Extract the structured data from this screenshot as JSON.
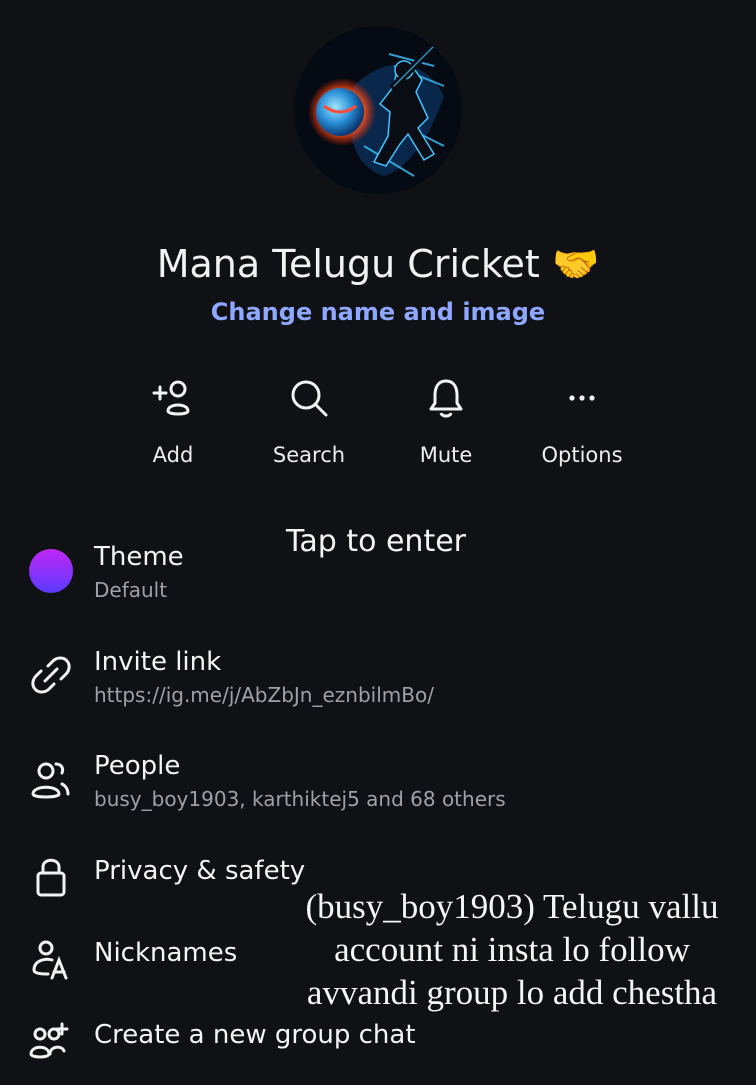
{
  "group": {
    "name": "Mana Telugu Cricket",
    "emoji": "🤝",
    "change_link": "Change name and image"
  },
  "actions": [
    {
      "label": "Add",
      "icon": "add-person-icon"
    },
    {
      "label": "Search",
      "icon": "search-icon"
    },
    {
      "label": "Mute",
      "icon": "bell-icon"
    },
    {
      "label": "Options",
      "icon": "more-dots-icon"
    }
  ],
  "overlay": {
    "tap_text": "Tap to enter",
    "note": "(busy_boy1903) Telugu vallu account ni insta lo follow avvandi group lo add chestha"
  },
  "menu": {
    "theme": {
      "title": "Theme",
      "subtitle": "Default",
      "colors": [
        "#c026f5",
        "#5a3bff"
      ]
    },
    "invite": {
      "title": "Invite link",
      "subtitle": "https://ig.me/j/AbZbJn_eznbilmBo/"
    },
    "people": {
      "title": "People",
      "subtitle": "busy_boy1903, karthiktej5 and 68 others"
    },
    "privacy": {
      "title": "Privacy & safety"
    },
    "nicknames": {
      "title": "Nicknames"
    },
    "create_group": {
      "title": "Create a new group chat"
    }
  },
  "colors": {
    "background": "#0f1115",
    "accent_link": "#8ea8ff"
  }
}
